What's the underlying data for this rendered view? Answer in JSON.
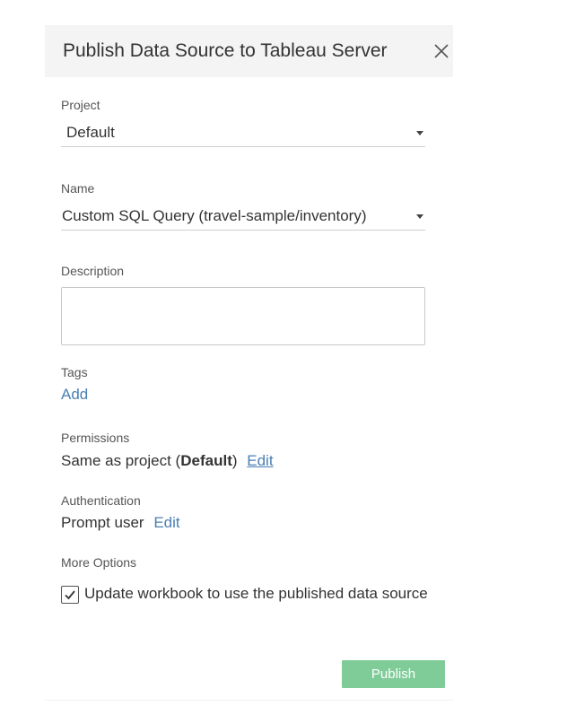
{
  "dialog": {
    "title": "Publish Data Source to Tableau Server"
  },
  "project": {
    "label": "Project",
    "value": "Default"
  },
  "name": {
    "label": "Name",
    "value": "Custom SQL Query (travel-sample/inventory)"
  },
  "description": {
    "label": "Description",
    "value": "",
    "placeholder": ""
  },
  "tags": {
    "label": "Tags",
    "add_link": "Add"
  },
  "permissions": {
    "label": "Permissions",
    "prefix": "Same as project (",
    "project_name": "Default",
    "suffix": ")",
    "edit_link": "Edit"
  },
  "authentication": {
    "label": "Authentication",
    "value": "Prompt user",
    "edit_link": "Edit"
  },
  "more_options": {
    "label": "More Options",
    "update_workbook_label": "Update workbook to use the published data source",
    "update_workbook_checked": true
  },
  "footer": {
    "publish_label": "Publish"
  },
  "colors": {
    "link": "#4a7fb3",
    "publish_button": "#7fcc98",
    "header_bg": "#f4f4f4"
  },
  "icons": {
    "close": "close-icon",
    "dropdown": "caret-down-icon",
    "check": "checkmark-icon"
  }
}
